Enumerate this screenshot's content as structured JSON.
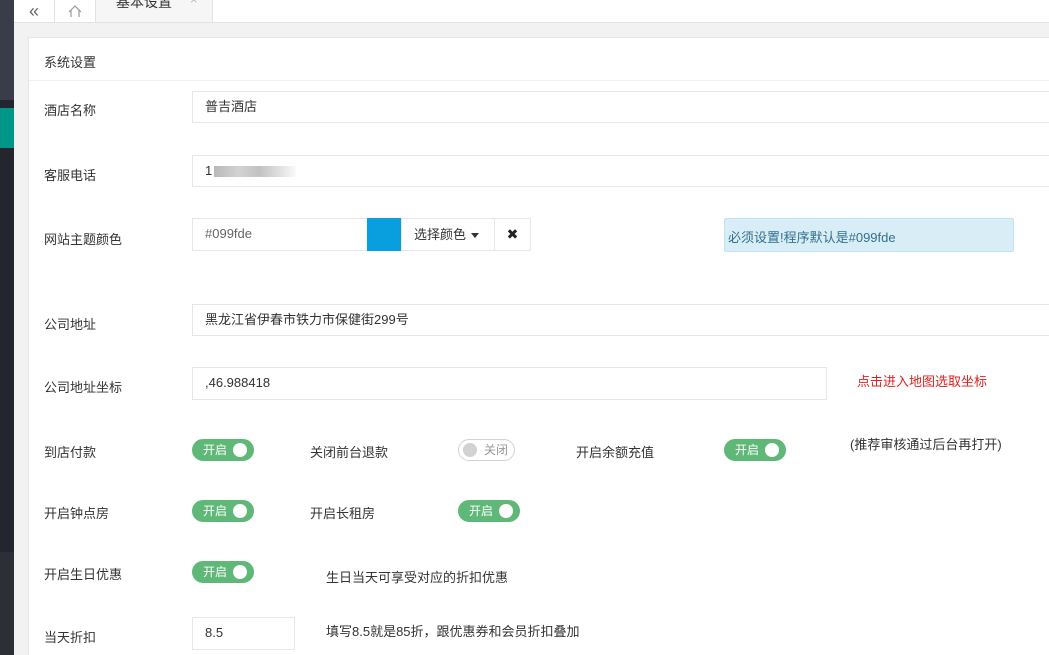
{
  "tabs": {
    "active_label": "基本设置",
    "close_glyph": "×",
    "collapse_glyph": "«",
    "home_icon": "home-icon"
  },
  "panel": {
    "title": "系统设置"
  },
  "form": {
    "hotel_name": {
      "label": "酒店名称",
      "value": "普吉酒店"
    },
    "service_phone": {
      "label": "客服电话",
      "value_visible": "1"
    },
    "theme_color": {
      "label": "网站主题颜色",
      "placeholder": "#099fde",
      "swatch_color": "#099fde",
      "picker_label": "选择颜色",
      "clear_glyph": "✖",
      "notice": "必须设置!程序默认是#099fde"
    },
    "address": {
      "label": "公司地址",
      "value": "黑龙江省伊春市铁力市保健街299号"
    },
    "coordinates": {
      "label": "公司地址坐标",
      "value": ",46.988418",
      "map_link": "点击进入地图选取坐标"
    },
    "toggles_row1": [
      {
        "label": "到店付款",
        "state": "开启",
        "on": true
      },
      {
        "label": "关闭前台退款",
        "state": "关闭",
        "on": false
      },
      {
        "label": "开启余额充值",
        "state": "开启",
        "on": true
      }
    ],
    "recharge_note": "(推荐审核通过后台再打开)",
    "toggles_row2": [
      {
        "label": "开启钟点房",
        "state": "开启",
        "on": true
      },
      {
        "label": "开启长租房",
        "state": "开启",
        "on": true
      }
    ],
    "birthday": {
      "label": "开启生日优惠",
      "state": "开启",
      "on": true,
      "note": "生日当天可享受对应的折扣优惠"
    },
    "discount": {
      "label": "当天折扣",
      "value": "8.5",
      "note": "填写8.5就是85折，跟优惠券和会员折扣叠加"
    }
  },
  "colors": {
    "switch_on": "#5fb878",
    "notice_bg": "#d9edf7",
    "link_red": "#e02020",
    "sidebar_accent": "#009688"
  }
}
